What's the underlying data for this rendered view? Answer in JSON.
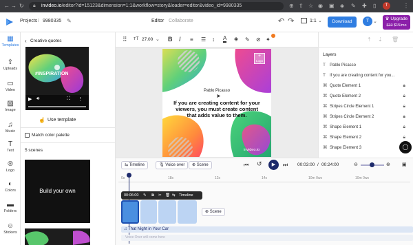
{
  "browser": {
    "url_host": "invideo.io",
    "url_path": "/editor?id=15123&dimension=1:1&workflow=story&loader=editor&video_id=9980335"
  },
  "header": {
    "breadcrumb_projects": "Projects",
    "breadcrumb_sep": "/",
    "project_id": "9980335",
    "tab_editor": "Editor",
    "tab_collaborate": "Collaborate",
    "ratio": "1:1",
    "download_label": "Download",
    "avatar_letter": "T",
    "upgrade_label": "Upgrade",
    "price_old": "$30",
    "price_new": "$15/mo"
  },
  "sidebar": {
    "items": [
      {
        "label": "Templates",
        "icon": "▦"
      },
      {
        "label": "Uploads",
        "icon": "⇪"
      },
      {
        "label": "Video",
        "icon": "▭"
      },
      {
        "label": "Image",
        "icon": "▨"
      },
      {
        "label": "Music",
        "icon": "♫"
      },
      {
        "label": "Text",
        "icon": "T"
      },
      {
        "label": "Logo",
        "icon": "®"
      },
      {
        "label": "Colors",
        "icon": "◐"
      },
      {
        "label": "Folders",
        "icon": "▬"
      },
      {
        "label": "Stickers",
        "icon": "☺"
      }
    ]
  },
  "panel": {
    "back_title": "Creative quotes",
    "preview_text_big": "#INSPIRATION",
    "use_template_label": "Use template",
    "match_palette_label": "Match color palette",
    "scenes_count_label": "5 scenes",
    "scene1_label": "Build your own"
  },
  "toolbar": {
    "font_size": "27.00"
  },
  "canvas": {
    "author": "Pablo Picasso",
    "quote": "If you are creating content for your viewers, you must create content that adds value to them.",
    "logo_label": "Logo",
    "watermark": "invideo.io"
  },
  "layers": {
    "title": "Layers",
    "items": [
      {
        "icon": "T",
        "label": "Pablo Picasso",
        "locked": false
      },
      {
        "icon": "T",
        "label": "If you are creating content for you...",
        "locked": false
      },
      {
        "icon": "⌘",
        "label": "Quote Element 1",
        "locked": true
      },
      {
        "icon": "⌘",
        "label": "Quote Element 2",
        "locked": true
      },
      {
        "icon": "⌘",
        "label": "Stripes Circle Element 1",
        "locked": true
      },
      {
        "icon": "⌘",
        "label": "Stripes Circle Element 2",
        "locked": true
      },
      {
        "icon": "⌘",
        "label": "Shape Element 1",
        "locked": true
      },
      {
        "icon": "⌘",
        "label": "Shape Element 2",
        "locked": true
      },
      {
        "icon": "⌘",
        "label": "Shape Element 3",
        "locked": true
      }
    ]
  },
  "timeline": {
    "timeline_label": "Timeline",
    "voiceover_label": "Voice over",
    "scene_label": "Scene",
    "current_time": "00:03:00",
    "total_time": "00:24:00",
    "time_sep": "/",
    "ruler_ticks": [
      "0s",
      "18s",
      "12s",
      "14s",
      "10m 0ws",
      "10m 0ws"
    ],
    "clip_time": "00:06:00",
    "clip_timeline_label": "Timeline",
    "add_scene_label": "Scene",
    "audio_track": "That Night in Your Car",
    "voice_hint": "Voice Over will come here"
  },
  "colors": {
    "accent": "#2f7de1",
    "upgrade": "#8b1fa9",
    "chrome": "#3a3b3f"
  }
}
